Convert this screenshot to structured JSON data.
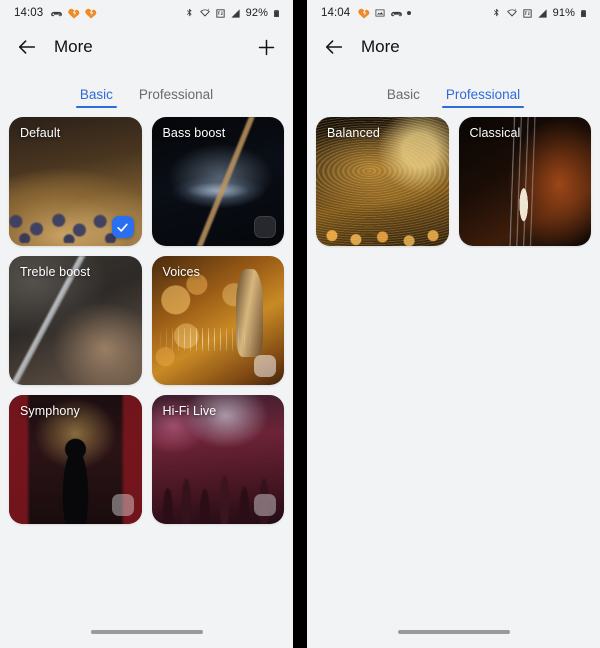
{
  "theme": {
    "page_background": "#f2f3f5",
    "accent": "#2f6bd8",
    "check_badge": "#2a6ff0",
    "divider": "#000000",
    "text_primary": "#101010",
    "text_muted": "#6a6a6d"
  },
  "panels": [
    {
      "name": "left-panel",
      "status_bar": {
        "time": "14:03",
        "left_icons": [
          "game-controller-icon",
          "heart-break-icon",
          "heart-break-icon"
        ],
        "right_icons": [
          "bluetooth-icon",
          "wifi-icon",
          "nfc-icon",
          "signal-bars-icon"
        ],
        "battery_text": "92%",
        "battery_icon": "battery-full-icon"
      },
      "app_bar": {
        "back_icon": "back-arrow-icon",
        "title": "More",
        "action_icon": "plus-icon",
        "has_action": true
      },
      "tabs": [
        {
          "label": "Basic",
          "active": true
        },
        {
          "label": "Professional",
          "active": false
        }
      ],
      "cards": [
        {
          "label": "Default",
          "art": "bg-mixer",
          "badge": "check"
        },
        {
          "label": "Bass boost",
          "art": "bg-drum",
          "badge": "ghost-dark"
        },
        {
          "label": "Treble boost",
          "art": "bg-flute",
          "badge": "none"
        },
        {
          "label": "Voices",
          "art": "bg-mic",
          "badge": "ghost-light"
        },
        {
          "label": "Symphony",
          "art": "bg-symphony",
          "badge": "ghost-mid"
        },
        {
          "label": "Hi-Fi Live",
          "art": "bg-hifi",
          "badge": "ghost-mid"
        }
      ],
      "home_indicator": "home-indicator-bar"
    },
    {
      "name": "right-panel",
      "status_bar": {
        "time": "14:04",
        "left_icons": [
          "heart-break-icon",
          "image-icon",
          "game-controller-icon",
          "dot-icon"
        ],
        "right_icons": [
          "bluetooth-icon",
          "wifi-icon",
          "nfc-icon",
          "signal-bars-icon"
        ],
        "battery_text": "91%",
        "battery_icon": "battery-full-icon"
      },
      "app_bar": {
        "back_icon": "back-arrow-icon",
        "title": "More",
        "action_icon": "plus-icon",
        "has_action": false
      },
      "tabs": [
        {
          "label": "Basic",
          "active": false
        },
        {
          "label": "Professional",
          "active": true
        }
      ],
      "cards": [
        {
          "label": "Balanced",
          "art": "bg-turntable",
          "badge": "none"
        },
        {
          "label": "Classical",
          "art": "bg-violin",
          "badge": "none"
        }
      ],
      "home_indicator": "home-indicator-bar"
    }
  ]
}
